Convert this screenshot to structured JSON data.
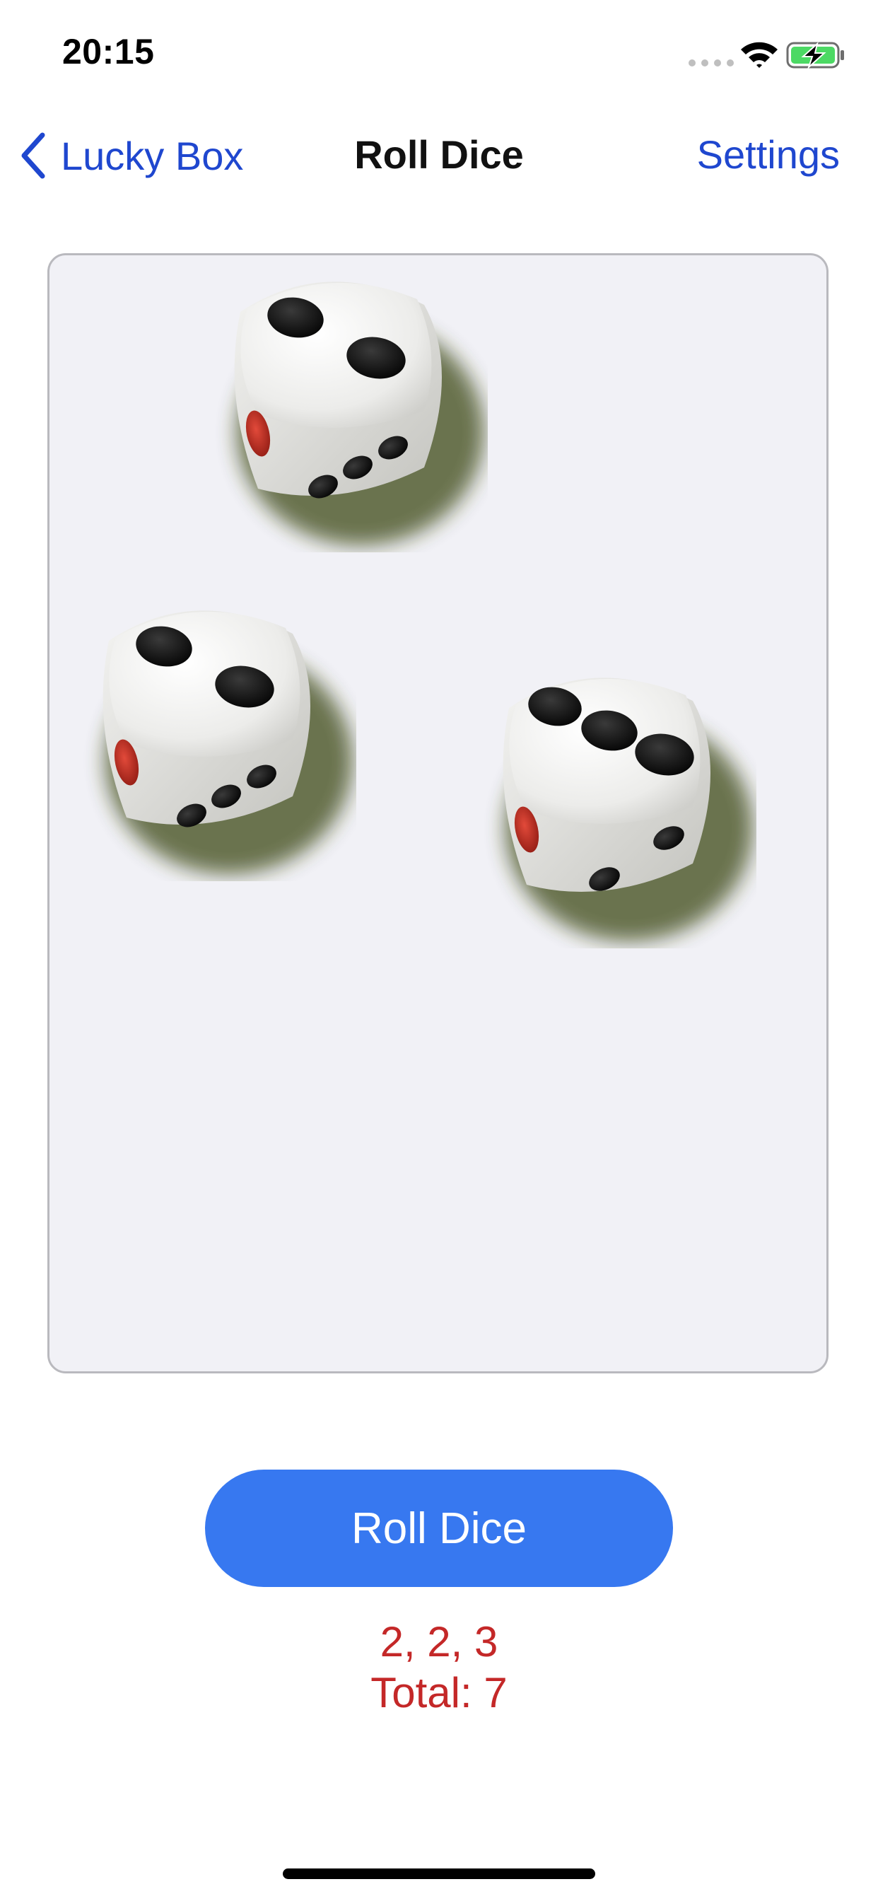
{
  "status_bar": {
    "time": "20:15",
    "icons": [
      "signal-icon",
      "wifi-icon",
      "battery-charging-icon"
    ],
    "battery_color": "#4cd964"
  },
  "nav": {
    "back_label": "Lucky Box",
    "title": "Roll Dice",
    "right_label": "Settings",
    "tint_color": "#1f47cf"
  },
  "dice_area": {
    "dice": [
      {
        "name": "die-1",
        "top_face": 2
      },
      {
        "name": "die-2",
        "top_face": 2
      },
      {
        "name": "die-3",
        "top_face": 3
      }
    ]
  },
  "action": {
    "button_label": "Roll Dice",
    "button_color": "#3778f0"
  },
  "result": {
    "values_text": "2, 2, 3",
    "total_text": "Total: 7",
    "color": "#c42828"
  }
}
